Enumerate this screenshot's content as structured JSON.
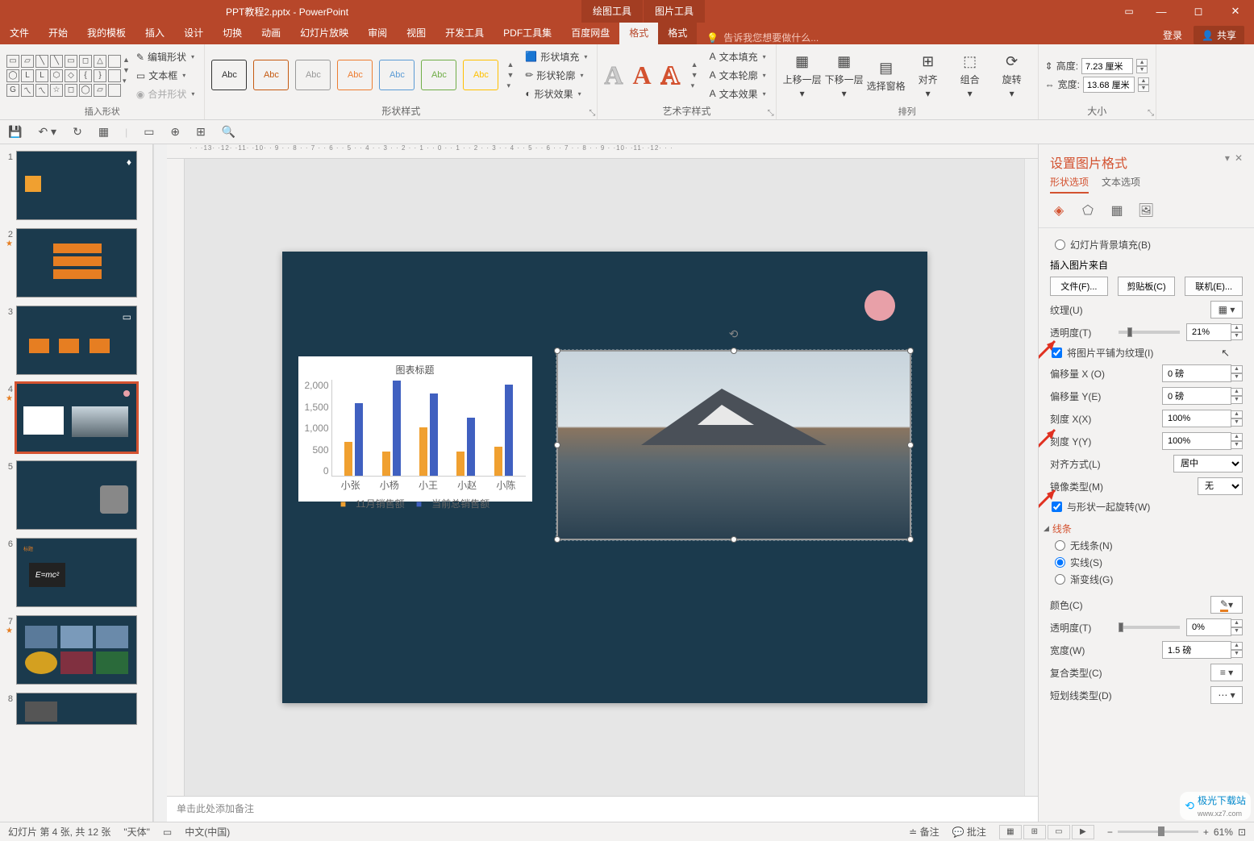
{
  "title": "PPT教程2.pptx - PowerPoint",
  "contextTools": [
    "绘图工具",
    "图片工具"
  ],
  "tabs": [
    "文件",
    "开始",
    "我的模板",
    "插入",
    "设计",
    "切换",
    "动画",
    "幻灯片放映",
    "审阅",
    "视图",
    "开发工具",
    "PDF工具集",
    "百度网盘"
  ],
  "contextTabs": [
    "格式",
    "格式"
  ],
  "tellme": "告诉我您想要做什么...",
  "account": {
    "login": "登录",
    "share": "共享"
  },
  "ribbon": {
    "insertShape": {
      "edit": "编辑形状",
      "textbox": "文本框",
      "merge": "合并形状",
      "label": "插入形状"
    },
    "shapeStyles": {
      "abc": "Abc",
      "fill": "形状填充",
      "outline": "形状轮廓",
      "effects": "形状效果",
      "label": "形状样式"
    },
    "wordart": {
      "fill": "文本填充",
      "outline": "文本轮廓",
      "effects": "文本效果",
      "label": "艺术字样式"
    },
    "arrange": {
      "forward": "上移一层",
      "backward": "下移一层",
      "pane": "选择窗格",
      "align": "对齐",
      "group": "组合",
      "rotate": "旋转",
      "label": "排列"
    },
    "size": {
      "height": "高度:",
      "heightVal": "7.23 厘米",
      "width": "宽度:",
      "widthVal": "13.68 厘米",
      "label": "大小"
    }
  },
  "chart_data": {
    "type": "bar",
    "title": "图表标题",
    "categories": [
      "小张",
      "小杨",
      "小王",
      "小赵",
      "小陈"
    ],
    "series": [
      {
        "name": "11月销售额",
        "values": [
          700,
          500,
          1000,
          500,
          600
        ]
      },
      {
        "name": "当前总销售额",
        "values": [
          1500,
          2000,
          1700,
          1200,
          1900
        ]
      }
    ],
    "ylim": [
      0,
      2000
    ],
    "yticks": [
      0,
      500,
      1000,
      1500,
      2000
    ]
  },
  "notes": "单击此处添加备注",
  "formatPane": {
    "title": "设置图片格式",
    "tabs": [
      "形状选项",
      "文本选项"
    ],
    "slideBgFill": "幻灯片背景填充(B)",
    "insertFrom": "插入图片来自",
    "fileBtn": "文件(F)...",
    "clipBtn": "剪贴板(C)",
    "onlineBtn": "联机(E)...",
    "texture": "纹理(U)",
    "transparency": "透明度(T)",
    "transparencyVal": "21%",
    "tile": "将图片平铺为纹理(I)",
    "offsetX": "偏移量 X (O)",
    "offsetXVal": "0 磅",
    "offsetY": "偏移量 Y(E)",
    "offsetYVal": "0 磅",
    "scaleX": "刻度 X(X)",
    "scaleXVal": "100%",
    "scaleY": "刻度 Y(Y)",
    "scaleYVal": "100%",
    "alignment": "对齐方式(L)",
    "alignmentVal": "居中",
    "mirror": "镜像类型(M)",
    "mirrorVal": "无",
    "rotateWith": "与形状一起旋转(W)",
    "lineSection": "线条",
    "noLine": "无线条(N)",
    "solid": "实线(S)",
    "gradient": "渐变线(G)",
    "color": "颜色(C)",
    "transparency2": "透明度(T)",
    "trans2Val": "0%",
    "width": "宽度(W)",
    "widthVal": "1.5 磅",
    "compound": "复合类型(C)",
    "dash": "短划线类型(D)"
  },
  "status": {
    "slideInfo": "幻灯片 第 4 张, 共 12 张",
    "lang": "\"天体\"",
    "ime": "中文(中国)",
    "notes": "备注",
    "comments": "批注",
    "zoom": "61%"
  },
  "watermark": "极光下载站",
  "watermarkUrl": "www.xz7.com"
}
